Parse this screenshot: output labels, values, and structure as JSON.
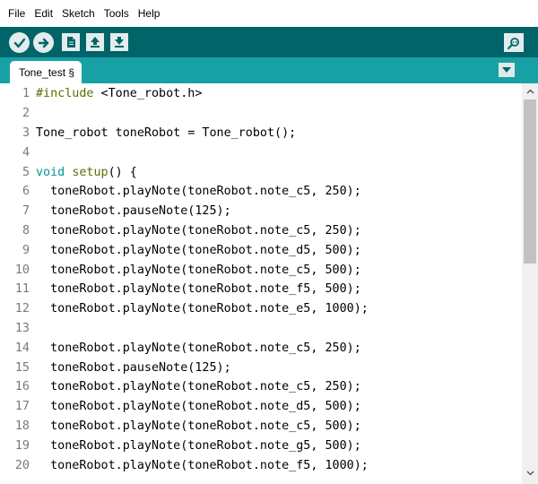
{
  "menu": {
    "items": [
      "File",
      "Edit",
      "Sketch",
      "Tools",
      "Help"
    ]
  },
  "toolbar": {
    "buttons": [
      "verify-icon",
      "upload-icon",
      "new-icon",
      "open-icon",
      "save-icon"
    ],
    "right_button": "serial-monitor-icon",
    "colors": {
      "bar": "#006468",
      "button": "#e3ecec"
    }
  },
  "tabs": {
    "active_tab": "Tone_test §",
    "menu_icon": "tab-menu-icon",
    "colors": {
      "strip": "#17a1a5"
    }
  },
  "editor": {
    "lines": [
      {
        "num": "1",
        "tokens": [
          {
            "t": "#include",
            "c": "kw-pre"
          },
          {
            "t": " <Tone_robot.h>",
            "c": ""
          }
        ]
      },
      {
        "num": "2",
        "tokens": []
      },
      {
        "num": "3",
        "tokens": [
          {
            "t": "Tone_robot toneRobot = Tone_robot();",
            "c": ""
          }
        ]
      },
      {
        "num": "4",
        "tokens": []
      },
      {
        "num": "5",
        "tokens": [
          {
            "t": "void",
            "c": "kw-type"
          },
          {
            "t": " ",
            "c": ""
          },
          {
            "t": "setup",
            "c": "kw-func"
          },
          {
            "t": "() {",
            "c": ""
          }
        ]
      },
      {
        "num": "6",
        "tokens": [
          {
            "t": "  toneRobot.playNote(toneRobot.note_c5, 250);",
            "c": ""
          }
        ]
      },
      {
        "num": "7",
        "tokens": [
          {
            "t": "  toneRobot.pauseNote(125);",
            "c": ""
          }
        ]
      },
      {
        "num": "8",
        "tokens": [
          {
            "t": "  toneRobot.playNote(toneRobot.note_c5, 250);",
            "c": ""
          }
        ]
      },
      {
        "num": "9",
        "tokens": [
          {
            "t": "  toneRobot.playNote(toneRobot.note_d5, 500);",
            "c": ""
          }
        ]
      },
      {
        "num": "10",
        "tokens": [
          {
            "t": "  toneRobot.playNote(toneRobot.note_c5, 500);",
            "c": ""
          }
        ]
      },
      {
        "num": "11",
        "tokens": [
          {
            "t": "  toneRobot.playNote(toneRobot.note_f5, 500);",
            "c": ""
          }
        ]
      },
      {
        "num": "12",
        "tokens": [
          {
            "t": "  toneRobot.playNote(toneRobot.note_e5, 1000);",
            "c": ""
          }
        ]
      },
      {
        "num": "13",
        "tokens": []
      },
      {
        "num": "14",
        "tokens": [
          {
            "t": "  toneRobot.playNote(toneRobot.note_c5, 250);",
            "c": ""
          }
        ]
      },
      {
        "num": "15",
        "tokens": [
          {
            "t": "  toneRobot.pauseNote(125);",
            "c": ""
          }
        ]
      },
      {
        "num": "16",
        "tokens": [
          {
            "t": "  toneRobot.playNote(toneRobot.note_c5, 250);",
            "c": ""
          }
        ]
      },
      {
        "num": "17",
        "tokens": [
          {
            "t": "  toneRobot.playNote(toneRobot.note_d5, 500);",
            "c": ""
          }
        ]
      },
      {
        "num": "18",
        "tokens": [
          {
            "t": "  toneRobot.playNote(toneRobot.note_c5, 500);",
            "c": ""
          }
        ]
      },
      {
        "num": "19",
        "tokens": [
          {
            "t": "  toneRobot.playNote(toneRobot.note_g5, 500);",
            "c": ""
          }
        ]
      },
      {
        "num": "20",
        "tokens": [
          {
            "t": "  toneRobot.playNote(toneRobot.note_f5, 1000);",
            "c": ""
          }
        ]
      }
    ],
    "colors": {
      "preprocessor": "#5e6d03",
      "type": "#00979c",
      "function": "#5e6d03",
      "line_number": "#7a7a7a"
    }
  },
  "scrollbar": {
    "up_icon": "scroll-up-icon",
    "down_icon": "scroll-down-icon"
  }
}
